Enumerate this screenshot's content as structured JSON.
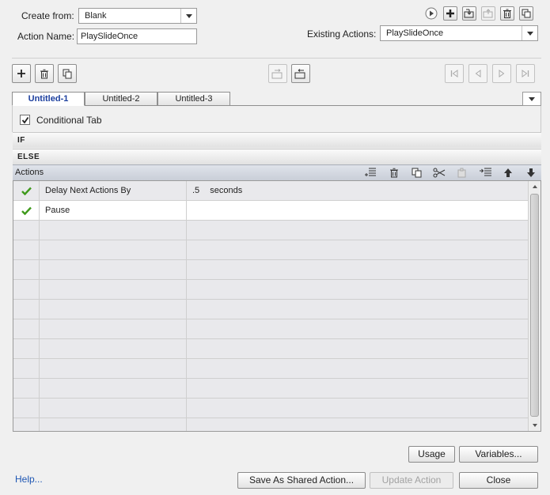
{
  "header": {
    "create_from_label": "Create from:",
    "create_from_value": "Blank",
    "action_name_label": "Action Name:",
    "action_name_value": "PlaySlideOnce",
    "existing_actions_label": "Existing Actions:",
    "existing_actions_value": "PlaySlideOnce"
  },
  "tabs": [
    {
      "label": "Untitled-1"
    },
    {
      "label": "Untitled-2"
    },
    {
      "label": "Untitled-3"
    }
  ],
  "conditional_tab_label": "Conditional Tab",
  "if_label": "IF",
  "else_label": "ELSE",
  "actions_label": "Actions",
  "rows": [
    {
      "action": "Delay Next Actions By",
      "value": ".5",
      "unit": "seconds"
    },
    {
      "action": "Pause",
      "value": "",
      "unit": ""
    }
  ],
  "footer": {
    "usage": "Usage",
    "variables": "Variables...",
    "help": "Help...",
    "save_shared": "Save As Shared Action...",
    "update_action": "Update Action",
    "close": "Close"
  },
  "colors": {
    "accent": "#1c3f9e",
    "check": "#3f9a1c",
    "link": "#1e56b3"
  }
}
